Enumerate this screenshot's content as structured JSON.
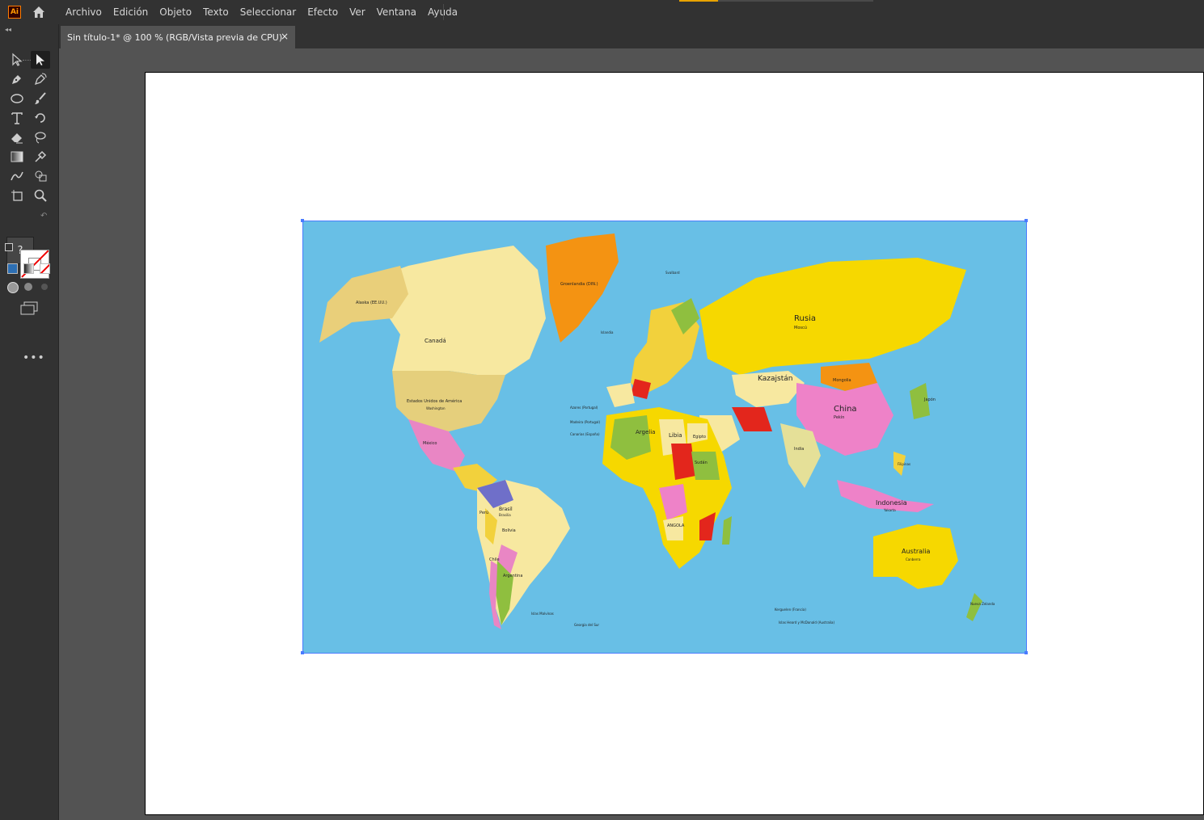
{
  "app": {
    "logo_text": "Ai",
    "menu": [
      "Archivo",
      "Edición",
      "Objeto",
      "Texto",
      "Seleccionar",
      "Efecto",
      "Ver",
      "Ventana",
      "Ayuda"
    ]
  },
  "document": {
    "tab_title": "Sin título-1* @ 100 % (RGB/Vista previa de CPU)",
    "close_glyph": "×"
  },
  "toolbar": {
    "fill_glyph": "?",
    "more_glyph": "•••",
    "tools": [
      "selection-tool",
      "direct-selection-tool",
      "pen-tool",
      "curvature-tool",
      "ellipse-tool",
      "paintbrush-tool",
      "type-tool",
      "rotate-tool",
      "eraser-tool",
      "lasso-tool",
      "gradient-tool",
      "eyedropper-tool",
      "blend-tool",
      "shape-builder-tool",
      "artboard-tool",
      "zoom-tool"
    ]
  },
  "map": {
    "labels": {
      "canada": "Canadá",
      "alaska": "Alaska (EE.UU.)",
      "usa": "Estados Unidos de América",
      "usa_cap": "Washington",
      "greenland": "Groenlandia (DIN.)",
      "russia": "Rusia",
      "russia_cap": "Moscú",
      "kazakhstan": "Kazajstán",
      "mongolia": "Mongolia",
      "china": "China",
      "china_cap": "Pekín",
      "india": "India",
      "mexico": "México",
      "brazil": "Brasil",
      "brazil_cap": "Brasilia",
      "argentina": "Argentina",
      "chile": "Chile",
      "peru": "Perú",
      "bolivia": "Bolivia",
      "algeria": "Argelia",
      "libya": "Libia",
      "egypt": "Egipto",
      "sudan": "Sudán",
      "angola": "ANGOLA",
      "australia": "Australia",
      "australia_cap": "Canberra",
      "indonesia": "Indonesia",
      "indonesia_cap": "Yakarta",
      "japan": "Japón",
      "falklands": "Islas Malvinas",
      "south_georgia": "Georgia del Sur",
      "kerguelen": "Kerguelen (Francia)",
      "heard": "Islas Heard y McDonald (Australia)",
      "iceland": "Islandia",
      "svalbard": "Svalbard",
      "azores": "Azores (Portugal)",
      "madeira": "Madeira (Portugal)",
      "canarias": "Canarias (España)",
      "new_zealand": "Nueva Zelanda",
      "philippines": "Filipinas"
    }
  }
}
